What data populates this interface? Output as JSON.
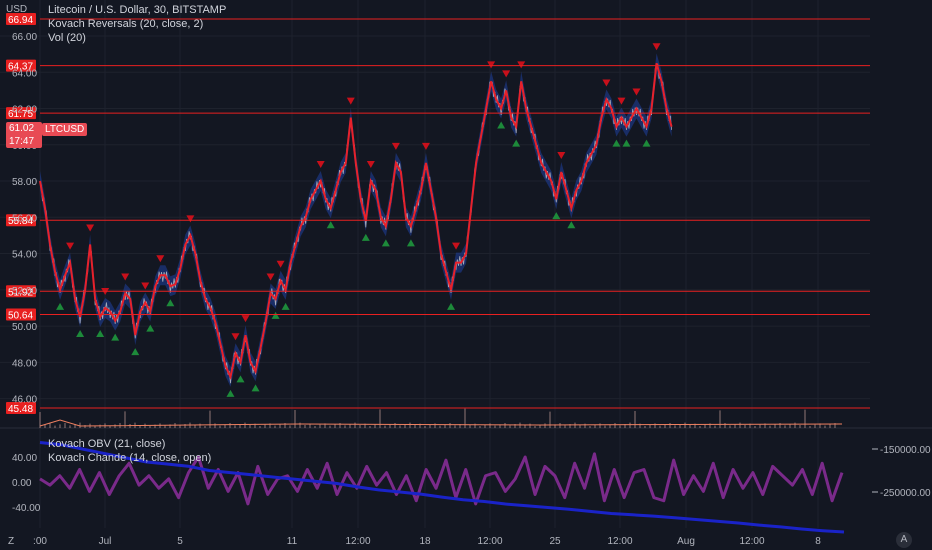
{
  "header": {
    "title": "Litecoin / U.S. Dollar, 30, BITSTAMP",
    "indicator_1": "Kovach Reversals (20, close, 2)",
    "indicator_2": "Vol (20)",
    "currency": "USD"
  },
  "lower_pane": {
    "indicator_1": "Kovach OBV (21, close)",
    "indicator_2": "Kovach Chande (14, close, open)"
  },
  "price_badge": {
    "symbol": "LTCUSD",
    "last": "61.02",
    "countdown": "17:47"
  },
  "y_axis_ticks": [
    "66.00",
    "64.00",
    "62.00",
    "60.00",
    "58.00",
    "56.00",
    "54.00",
    "52.00",
    "50.00",
    "48.00",
    "46.00"
  ],
  "hlines": [
    "66.94",
    "64.37",
    "61.75",
    "55.84",
    "51.92",
    "50.64",
    "45.48"
  ],
  "lower_left_ticks": [
    "40.00",
    "0.00",
    "-40.00"
  ],
  "lower_right_ticks": [
    "-150000.00",
    "-250000.00"
  ],
  "x_axis_ticks": [
    ":00",
    "Jul",
    "5",
    "11",
    "12:00",
    "18",
    "12:00",
    "25",
    "12:00",
    "Aug",
    "12:00",
    "8"
  ],
  "x_axis_tz": "Z",
  "x_axis_auto": "A",
  "colors": {
    "background": "#131722",
    "hline": "#e82020",
    "ma": "#e8212a",
    "band": "#1f3f9f",
    "price": "#c9cbd0",
    "chande": "#7a2a8a",
    "obv": "#1a23c8",
    "up_marker": "#1d8a3a",
    "down_marker": "#c8101b"
  },
  "chart_data": {
    "type": "line",
    "title": "Litecoin / U.S. Dollar, 30, BITSTAMP",
    "xlabel": "",
    "ylabel": "USD",
    "ylim": [
      45.2,
      67.6
    ],
    "x": [
      0,
      5,
      10,
      15,
      20,
      25,
      30,
      35,
      40,
      45,
      50,
      55,
      60,
      65,
      70,
      75,
      80,
      85,
      90,
      95,
      100,
      105,
      110,
      115,
      120,
      125,
      130,
      135,
      140,
      145,
      150,
      155,
      160,
      165,
      170,
      175,
      180,
      185,
      190,
      195,
      200,
      205,
      210,
      215,
      220,
      225,
      230,
      235,
      240,
      245,
      250,
      255,
      260,
      265,
      270,
      275,
      280,
      285,
      290,
      295,
      300,
      305,
      310,
      315,
      320,
      325,
      330,
      335,
      340,
      345,
      350,
      355,
      360,
      365,
      370,
      375,
      380,
      385,
      390,
      395,
      400,
      405,
      410,
      415,
      420,
      425,
      430,
      435,
      440,
      445,
      450,
      455,
      460,
      465,
      470,
      475,
      480,
      485,
      490,
      495,
      500,
      505,
      510,
      515,
      520,
      525,
      530,
      535,
      540,
      545,
      550,
      555,
      560,
      565,
      570,
      575,
      580,
      585,
      590,
      595,
      600,
      605,
      610,
      615,
      620,
      625,
      630,
      635,
      640,
      645,
      650,
      655,
      660,
      665,
      670,
      675,
      680,
      685,
      690,
      695,
      700,
      705,
      710,
      715,
      720,
      725,
      730,
      735,
      740,
      745,
      750,
      755,
      760,
      765,
      770,
      775,
      780,
      785,
      790,
      795,
      800
    ],
    "series": [
      {
        "name": "LTCUSD",
        "values": [
          58.0,
          56.5,
          54.5,
          53.0,
          52.0,
          52.8,
          53.5,
          51.5,
          50.5,
          52.0,
          54.5,
          51.5,
          50.5,
          51.0,
          50.8,
          50.3,
          50.8,
          51.8,
          51.5,
          49.5,
          50.8,
          51.3,
          50.8,
          52.2,
          52.8,
          52.8,
          52.2,
          52.3,
          53.2,
          54.5,
          55.0,
          54.0,
          52.5,
          51.5,
          51.0,
          50.2,
          49.0,
          47.8,
          47.2,
          48.5,
          48.0,
          49.5,
          48.0,
          47.5,
          48.8,
          50.2,
          51.8,
          51.5,
          52.5,
          52.0,
          53.5,
          54.5,
          55.5,
          56.0,
          57.0,
          57.5,
          58.0,
          57.0,
          56.5,
          57.5,
          58.5,
          59.0,
          61.5,
          59.0,
          57.0,
          55.8,
          58.0,
          57.5,
          56.0,
          55.5,
          57.0,
          59.0,
          58.5,
          56.0,
          55.5,
          56.5,
          57.5,
          59.0,
          57.5,
          56.0,
          54.0,
          53.0,
          52.0,
          53.5,
          53.5,
          54.0,
          56.5,
          59.0,
          60.5,
          62.0,
          63.5,
          62.5,
          62.0,
          63.0,
          61.5,
          61.0,
          63.5,
          62.0,
          61.0,
          60.0,
          59.0,
          58.5,
          58.0,
          57.0,
          58.5,
          57.5,
          56.5,
          57.5,
          58.0,
          59.0,
          59.5,
          60.0,
          61.5,
          62.5,
          62.0,
          61.0,
          61.5,
          61.0,
          61.5,
          62.0,
          61.5,
          61.0,
          62.0,
          64.5,
          63.5,
          62.0,
          61.0
        ]
      },
      {
        "name": "OBV",
        "values": [
          -135000,
          -140000,
          -150000,
          -160000,
          -170000,
          -180000,
          -185000,
          -190000,
          -200000,
          -205000,
          -210000,
          -215000,
          -220000,
          -225000,
          -230000,
          -238000,
          -245000,
          -250000,
          -255000,
          -262000,
          -268000,
          -272000,
          -278000,
          -282000,
          -286000,
          -290000,
          -295000,
          -300000,
          -303000,
          -306000,
          -310000,
          -314000,
          -318000,
          -322000,
          -327000,
          -331000,
          -336000,
          -340000,
          -343000
        ]
      },
      {
        "name": "Chande",
        "values": [
          5,
          -5,
          10,
          -10,
          20,
          -15,
          15,
          -20,
          10,
          30,
          -5,
          10,
          -10,
          5,
          -25,
          15,
          40,
          -10,
          20,
          -15,
          15,
          -35,
          25,
          -20,
          5,
          10,
          -15,
          20,
          -10,
          30,
          -20,
          15,
          -10,
          25,
          -5,
          15,
          -20,
          10,
          -30,
          20,
          -10,
          35,
          -25,
          20,
          -35,
          10,
          15,
          -15,
          5,
          40,
          -20,
          25,
          10,
          -25,
          30,
          -10,
          45,
          -30,
          20,
          -25,
          15,
          20,
          -25,
          -30,
          35,
          -20,
          10,
          -15,
          30,
          -25,
          20,
          -10,
          15,
          -20,
          25,
          10,
          -5,
          20,
          -20,
          30,
          -30,
          15
        ]
      }
    ]
  }
}
